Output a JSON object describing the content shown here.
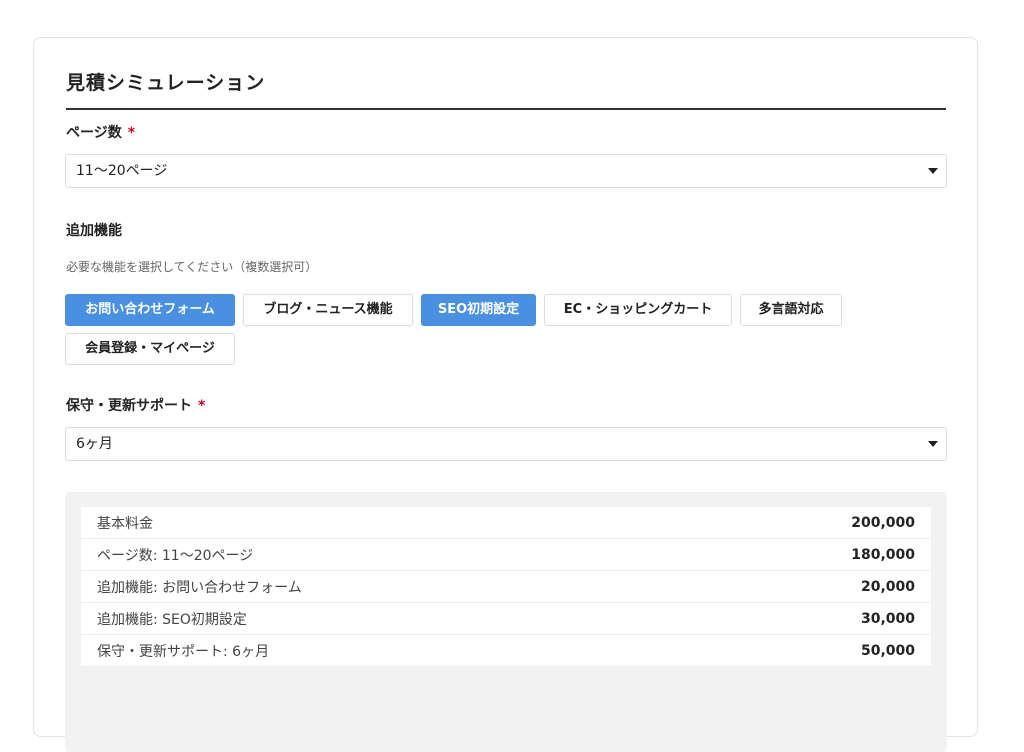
{
  "form": {
    "title": "見積シミュレーション",
    "pages": {
      "label": "ページ数",
      "required_mark": "*",
      "selected": "11〜20ページ"
    },
    "features": {
      "label": "追加機能",
      "hint": "必要な機能を選択してください（複数選択可）",
      "options": [
        {
          "label": "お問い合わせフォーム",
          "selected": true
        },
        {
          "label": "ブログ・ニュース機能",
          "selected": false
        },
        {
          "label": "SEO初期設定",
          "selected": true
        },
        {
          "label": "EC・ショッピングカート",
          "selected": false
        },
        {
          "label": "多言語対応",
          "selected": false
        },
        {
          "label": "会員登録・マイページ",
          "selected": false
        }
      ]
    },
    "support": {
      "label": "保守・更新サポート",
      "required_mark": "*",
      "selected": "6ヶ月"
    }
  },
  "summary": {
    "rows": [
      {
        "name": "基本料金",
        "value": "200,000"
      },
      {
        "name": "ページ数: 11〜20ページ",
        "value": "180,000"
      },
      {
        "name": "追加機能: お問い合わせフォーム",
        "value": "20,000"
      },
      {
        "name": "追加機能: SEO初期設定",
        "value": "30,000"
      },
      {
        "name": "保守・更新サポート: 6ヶ月",
        "value": "50,000"
      }
    ]
  },
  "colors": {
    "accent": "#4a90e2",
    "required": "#d0021b"
  }
}
